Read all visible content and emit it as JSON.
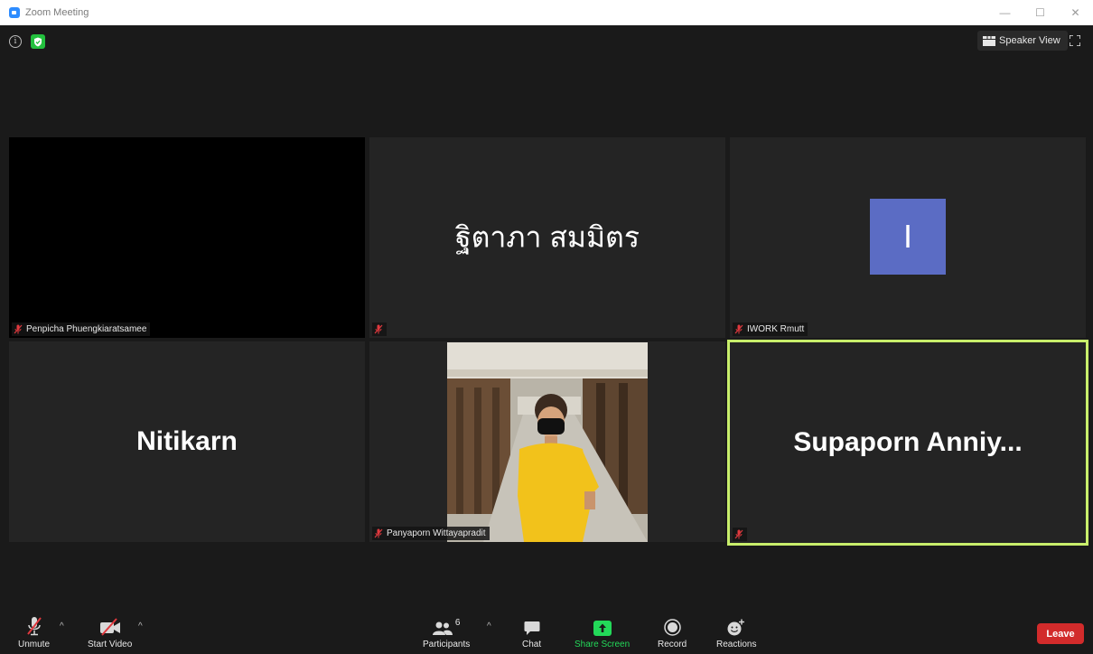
{
  "window": {
    "title": "Zoom Meeting",
    "minimize": "—",
    "maximize": "☐",
    "close": "✕"
  },
  "top_bar": {
    "info_glyph": "i",
    "speaker_view_label": "Speaker View"
  },
  "tiles": [
    {
      "id": "penpicha",
      "display_name": "",
      "name_tag": "Penpicha Phuengkiaratsamee",
      "video_on": true,
      "muted": true
    },
    {
      "id": "thai-name",
      "display_name": "ฐิตาภา สมมิตร",
      "name_tag": "",
      "video_on": false,
      "muted": true
    },
    {
      "id": "iwork",
      "display_name": "",
      "avatar_letter": "I",
      "avatar_color": "#5b6cc4",
      "name_tag": "IWORK Rmutt",
      "video_on": false,
      "muted": true
    },
    {
      "id": "nitikarn",
      "display_name": "Nitikarn",
      "name_tag": "",
      "video_on": false,
      "muted": false
    },
    {
      "id": "panyaporn",
      "display_name": "",
      "name_tag": "Panyaporn Wittayapradit",
      "video_on": true,
      "muted": true
    },
    {
      "id": "supaporn",
      "display_name": "Supaporn  Anniy...",
      "name_tag": "",
      "video_on": false,
      "muted": true,
      "active_speaker": true
    }
  ],
  "toolbar": {
    "unmute_label": "Unmute",
    "start_video_label": "Start Video",
    "participants_label": "Participants",
    "participants_count": "6",
    "chat_label": "Chat",
    "share_screen_label": "Share Screen",
    "record_label": "Record",
    "reactions_label": "Reactions",
    "leave_label": "Leave",
    "caret": "^"
  },
  "colors": {
    "accent_green": "#23d959",
    "leave_red": "#d22b2b",
    "active_border": "#c8ee6b",
    "muted_red": "#e0393e"
  }
}
